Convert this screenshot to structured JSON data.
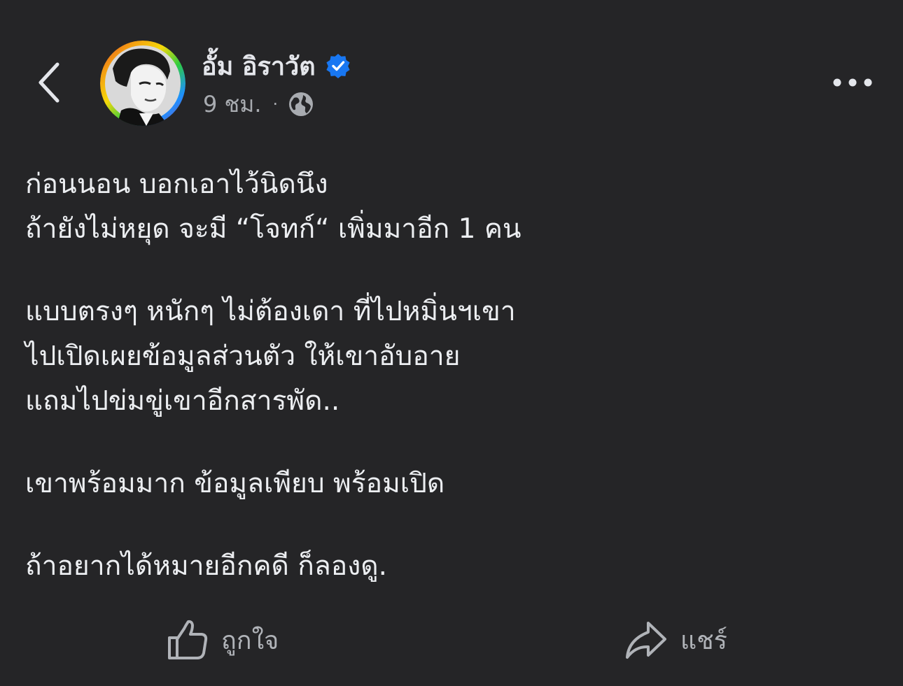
{
  "post": {
    "author_name": "อั้ม อิราวัต",
    "time": "9 ชม.",
    "separator": "·",
    "icons": {
      "back": "chevron-left-icon",
      "verified": "verified-badge-icon",
      "audience": "globe-icon",
      "more": "more-dots-icon"
    },
    "lines": [
      "ก่อนนอน บอกเอาไว้นิดนึง",
      "ถ้ายังไม่หยุด จะมี “โจทก์“ เพิ่มมาอีก 1 คน",
      "แบบตรงๆ หนักๆ ไม่ต้องเดา ที่ไปหมิ่นฯเขา",
      "ไปเปิดเผยข้อมูลส่วนตัว ให้เขาอับอาย",
      "แถมไปข่มขู่เขาอีกสารพัด..",
      "เขาพร้อมมาก ข้อมูลเพียบ พร้อมเปิด",
      "ถ้าอยากได้หมายอีกคดี ก็ลองดู."
    ]
  },
  "actions": {
    "like_label": "ถูกใจ",
    "share_label": "แชร์"
  },
  "colors": {
    "background": "#252527",
    "text": "#e4e6eb",
    "muted": "#a8abb0",
    "verified": "#1877f2"
  }
}
